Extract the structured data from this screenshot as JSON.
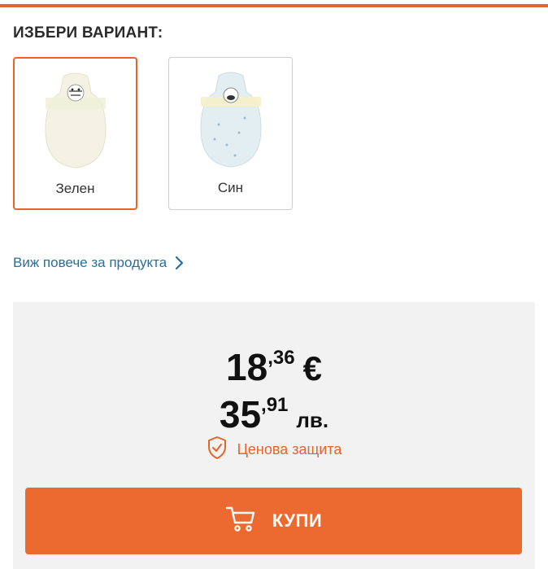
{
  "variants": {
    "heading": "ИЗБЕРИ ВАРИАНТ:",
    "items": [
      {
        "label": "Зелен",
        "selected": true,
        "color": "#f3f1e4"
      },
      {
        "label": "Син",
        "selected": false,
        "color": "#e3eef3"
      }
    ]
  },
  "product_link": {
    "label": "Виж повече за продукта",
    "icon": "chevron-right-icon"
  },
  "price": {
    "eur_main": "18",
    "eur_cents": ",36",
    "eur_currency": "€",
    "bgn_main": "35",
    "bgn_cents": ",91",
    "bgn_currency": "лв."
  },
  "protection": {
    "label": "Ценова защита",
    "icon": "shield-check-icon"
  },
  "buy_button": {
    "label": "КУПИ",
    "icon": "cart-icon"
  },
  "colors": {
    "accent": "#e8622a",
    "link": "#2a6f9a",
    "panel": "#f2f2f2"
  }
}
